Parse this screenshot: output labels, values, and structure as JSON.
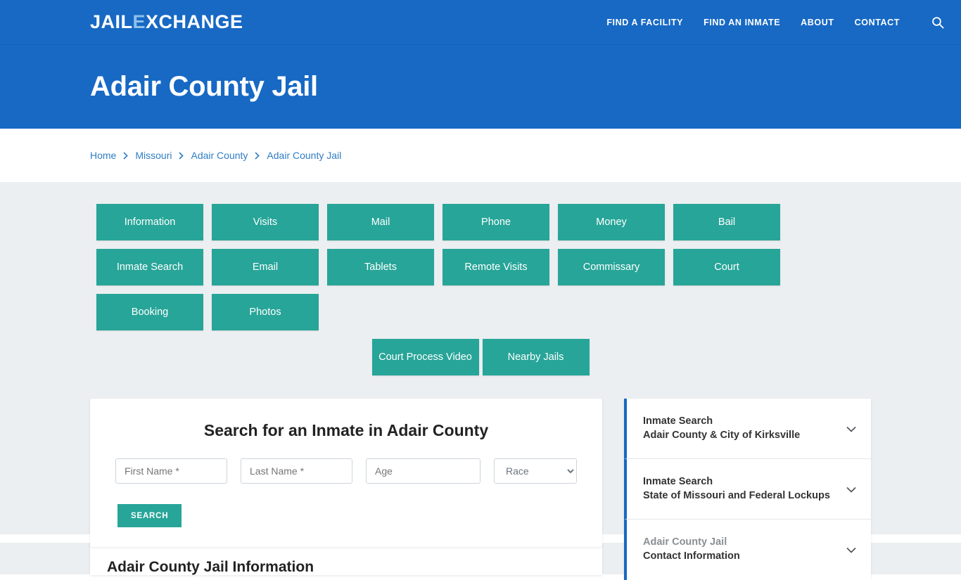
{
  "header": {
    "logo_part1": "JAIL",
    "logo_x": "E",
    "logo_part2": "XCHANGE",
    "nav": [
      {
        "label": "FIND A FACILITY"
      },
      {
        "label": "FIND AN INMATE"
      },
      {
        "label": "ABOUT"
      },
      {
        "label": "CONTACT"
      }
    ],
    "search_icon": "search-icon"
  },
  "page_title": "Adair County Jail",
  "breadcrumb": [
    {
      "label": "Home"
    },
    {
      "label": "Missouri"
    },
    {
      "label": "Adair County"
    },
    {
      "label": "Adair County Jail"
    }
  ],
  "nav_buttons": [
    {
      "label": "Information"
    },
    {
      "label": "Visits"
    },
    {
      "label": "Mail"
    },
    {
      "label": "Phone"
    },
    {
      "label": "Money"
    },
    {
      "label": "Bail"
    },
    {
      "label": "Inmate Search"
    },
    {
      "label": "Email"
    },
    {
      "label": "Tablets"
    },
    {
      "label": "Remote Visits"
    },
    {
      "label": "Commissary"
    },
    {
      "label": "Court"
    },
    {
      "label": "Booking"
    },
    {
      "label": "Photos"
    }
  ],
  "nav_buttons_row3": [
    {
      "label": "Court Process Video"
    },
    {
      "label": "Nearby Jails"
    }
  ],
  "search_card": {
    "heading": "Search for an Inmate in Adair County",
    "first_name_placeholder": "First Name *",
    "first_name_value": "",
    "last_name_placeholder": "Last Name *",
    "last_name_value": "",
    "age_placeholder": "Age",
    "age_value": "",
    "race_selected": "Race",
    "race_options": [
      "Race"
    ],
    "submit_label": "SEARCH"
  },
  "accordion": [
    {
      "line1": "Inmate Search",
      "line2": "Adair County & City of Kirksville",
      "muted": false
    },
    {
      "line1": "Inmate Search",
      "line2": "State of Missouri and Federal Lockups",
      "muted": false
    },
    {
      "line1": "Adair County Jail",
      "line2": "Contact Information",
      "muted": true
    }
  ],
  "info_section": {
    "heading": "Adair County Jail Information"
  },
  "colors": {
    "brand_blue": "#1769c4",
    "teal": "#27a598",
    "page_grey": "#eceff1",
    "link_blue": "#2f7dc4"
  }
}
